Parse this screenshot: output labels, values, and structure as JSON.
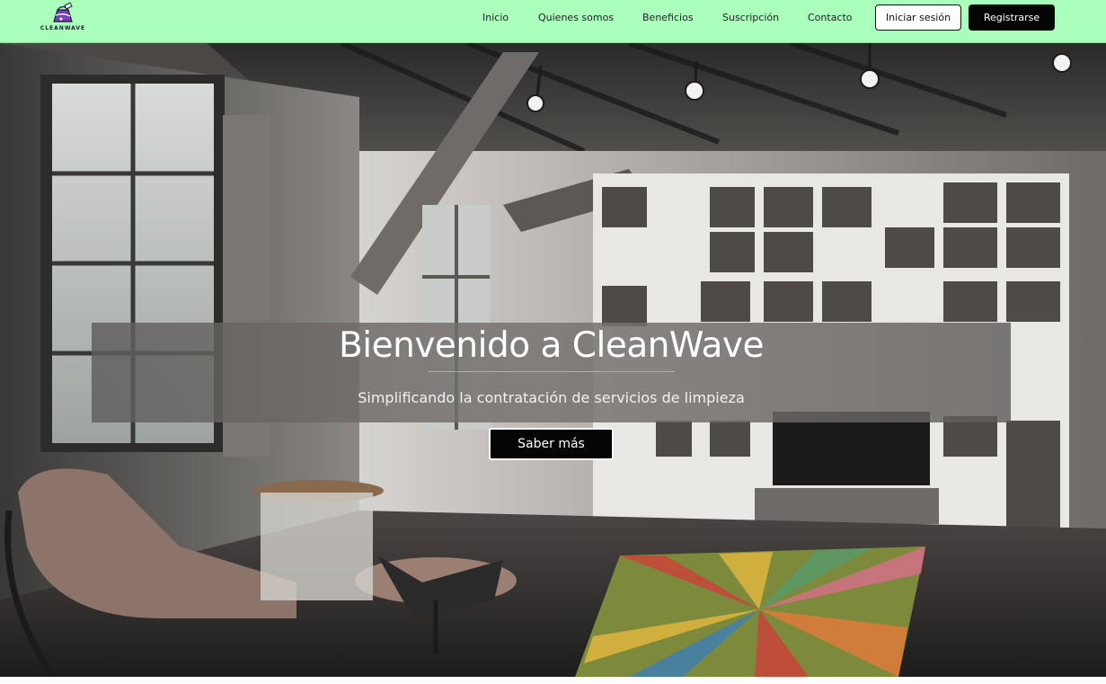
{
  "brand": {
    "name": "CLEANWAVE",
    "logo_icon": "cleaning-bucket-icon",
    "colors": {
      "navbar_bg": "#aaffbd",
      "primary_button": "#050505",
      "logo_purple": "#7a3fb8"
    }
  },
  "nav": {
    "items": [
      {
        "label": "Inicio"
      },
      {
        "label": "Quienes somos"
      },
      {
        "label": "Beneficios"
      },
      {
        "label": "Suscripción"
      },
      {
        "label": "Contacto"
      }
    ],
    "login_label": "Iniciar sesión",
    "register_label": "Registrarse"
  },
  "hero": {
    "title": "Bienvenido a CleanWave",
    "subtitle": "Simplificando la contratación de servicios de limpieza",
    "cta_label": "Saber más",
    "background_image": "loft-living-room-photo"
  }
}
